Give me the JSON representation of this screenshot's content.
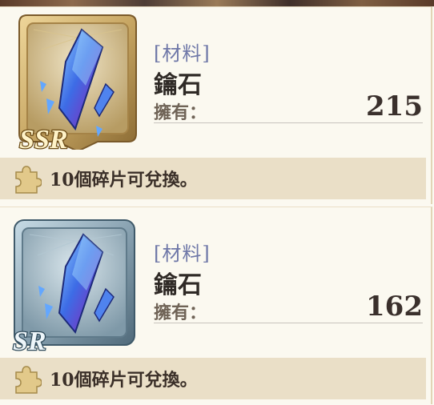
{
  "items": [
    {
      "rarity": "SSR",
      "rarity_badge_text": "SSR",
      "category": "[材料]",
      "name": "鑰石",
      "owned_label": "擁有：",
      "owned_value": "215",
      "exchange_text": "10個碎片可兌換。",
      "icon": "blue-crystal-icon",
      "frame_color": "#c7a663"
    },
    {
      "rarity": "SR",
      "rarity_badge_text": "SR",
      "category": "[材料]",
      "name": "鑰石",
      "owned_label": "擁有：",
      "owned_value": "162",
      "exchange_text": "10個碎片可兌換。",
      "icon": "blue-crystal-icon",
      "frame_color": "#8aa3b2"
    }
  ],
  "colors": {
    "category": "#6f78a8",
    "exchange_bar": "#eadfc7",
    "puzzle_icon": "#e2c98a"
  }
}
